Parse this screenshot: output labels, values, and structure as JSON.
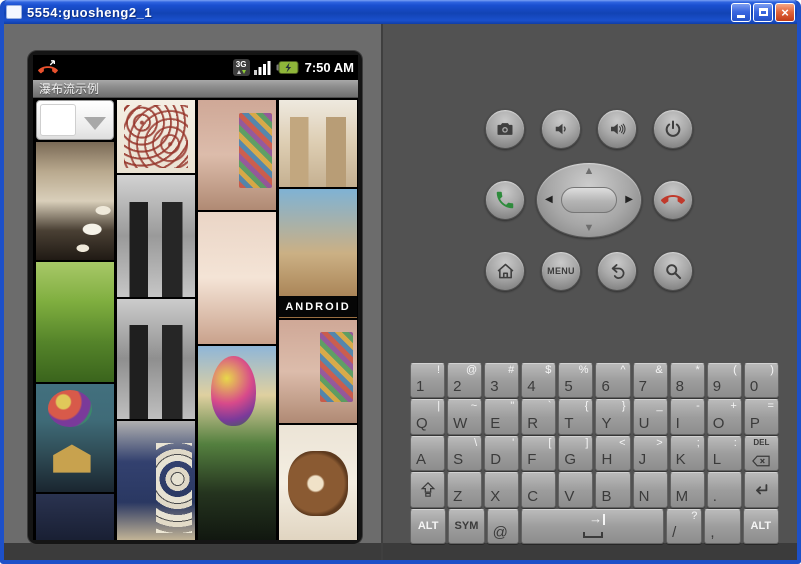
{
  "window": {
    "title": "5554:guosheng2_1",
    "controls": [
      {
        "name": "minimize",
        "icon": "underscore"
      },
      {
        "name": "maximize",
        "icon": "square"
      },
      {
        "name": "close",
        "icon": "x"
      }
    ]
  },
  "colors": {
    "titlebar_blue": "#1a4fd0",
    "panel_left": "#6c6c6c",
    "panel_right": "#525252",
    "call_green": "#2e8b3c",
    "hangup_red": "#c0392b",
    "battery_green": "#8fb63a",
    "missed_call_orange": "#e8512d",
    "key_main_text": "#3b3b3b",
    "key_alt_text": "#f5f5f5"
  },
  "device": {
    "status_bar": {
      "time": "7:50 AM",
      "network_label": "3G",
      "icons": [
        "missed-call",
        "3g-data",
        "signal-strength",
        "battery-charging"
      ]
    },
    "app_title": "瀑布流示例",
    "waterfall": {
      "columns": [
        [
          {
            "type": "spinner",
            "h": 40
          },
          {
            "label": "lily-portrait",
            "h": 118,
            "colors": [
              "#7a6a56",
              "#b9a98e",
              "#d9cfba",
              "#4a4034",
              "#201a14"
            ],
            "accent": "lily"
          },
          {
            "label": "meadow",
            "h": 120,
            "colors": [
              "#a8c868",
              "#7fae3f",
              "#55842a",
              "#3a641c"
            ]
          },
          {
            "label": "up-house-cake",
            "h": 108,
            "colors": [
              "#42707e",
              "#3f6b78",
              "#2e4a54",
              "#1a2630"
            ],
            "accent": "house"
          },
          {
            "label": "night-clouds",
            "h": 52,
            "colors": [
              "#2a3350",
              "#171d30"
            ]
          }
        ],
        [
          {
            "label": "caricatures",
            "h": 73,
            "colors": [
              "#f4efe4",
              "#eae1d2"
            ],
            "accent": "scribble"
          },
          {
            "label": "bw-models-1",
            "h": 122,
            "colors": [
              "#d2d2d2",
              "#9a9a9a",
              "#c6c6c6"
            ],
            "accent": "figures"
          },
          {
            "label": "bw-models-2",
            "h": 120,
            "colors": [
              "#cccccc",
              "#8f8f8f",
              "#bfbfbf"
            ],
            "accent": "figures"
          },
          {
            "label": "new-year-cookies",
            "h": 122,
            "colors": [
              "#b0b0b0",
              "#33416f",
              "#2a3862",
              "#cdbd9a"
            ],
            "accent": "clocks"
          }
        ],
        [
          {
            "label": "craft-shelf",
            "h": 110,
            "colors": [
              "#cfa897",
              "#dcbcab",
              "#b08a74"
            ],
            "accent": "patch"
          },
          {
            "label": "hands",
            "h": 132,
            "colors": [
              "#ead5c6",
              "#f4e4d6",
              "#c9a28c"
            ]
          },
          {
            "label": "balloon-landscape",
            "h": 196,
            "colors": [
              "#8fb6d8",
              "#dfd0a0",
              "#54803f",
              "#25341f",
              "#10160f"
            ],
            "accent": "balloon"
          }
        ],
        [
          {
            "label": "fashion-models",
            "h": 87,
            "colors": [
              "#eee9df",
              "#ddcdb2",
              "#c5b091"
            ],
            "accent": "models"
          },
          {
            "label": "beach-android",
            "h": 129,
            "colors": [
              "#7fb2d4",
              "#cbb084",
              "#9a6f42"
            ],
            "text": "ANDROID"
          },
          {
            "label": "craft-shelf-2",
            "h": 103,
            "colors": [
              "#cfa897",
              "#dcbcab",
              "#b08a74"
            ],
            "accent": "patch"
          },
          {
            "label": "swiss-roll",
            "h": 117,
            "colors": [
              "#ece4d6",
              "#f4eee2",
              "#e0d4c0"
            ],
            "accent": "roll"
          }
        ]
      ]
    }
  },
  "controls": {
    "row1": [
      "camera",
      "volume-down",
      "volume-up",
      "power"
    ],
    "row2": [
      "call",
      "dpad",
      "hang-up"
    ],
    "row3": [
      "home",
      "menu",
      "back",
      "search"
    ],
    "dpad": [
      "up",
      "down",
      "left",
      "right",
      "center"
    ],
    "menu_label": "MENU"
  },
  "keyboard": {
    "rows": [
      [
        {
          "m": "1",
          "a": "!"
        },
        {
          "m": "2",
          "a": "@"
        },
        {
          "m": "3",
          "a": "#"
        },
        {
          "m": "4",
          "a": "$"
        },
        {
          "m": "5",
          "a": "%"
        },
        {
          "m": "6",
          "a": "^"
        },
        {
          "m": "7",
          "a": "&"
        },
        {
          "m": "8",
          "a": "*"
        },
        {
          "m": "9",
          "a": "("
        },
        {
          "m": "0",
          "a": ")"
        }
      ],
      [
        {
          "m": "Q",
          "a": "|"
        },
        {
          "m": "W",
          "a": "~"
        },
        {
          "m": "E",
          "a": "\""
        },
        {
          "m": "R",
          "a": "`"
        },
        {
          "m": "T",
          "a": "{"
        },
        {
          "m": "Y",
          "a": "}"
        },
        {
          "m": "U",
          "a": "_"
        },
        {
          "m": "I",
          "a": "-"
        },
        {
          "m": "O",
          "a": "+"
        },
        {
          "m": "P",
          "a": "="
        }
      ],
      [
        {
          "m": "A"
        },
        {
          "m": "S",
          "a": "\\"
        },
        {
          "m": "D",
          "a": "'"
        },
        {
          "m": "F",
          "a": "["
        },
        {
          "m": "G",
          "a": "]"
        },
        {
          "m": "H",
          "a": "<"
        },
        {
          "m": "J",
          "a": ">"
        },
        {
          "m": "K",
          "a": ";"
        },
        {
          "m": "L",
          "a": ":"
        },
        {
          "type": "del",
          "label": "DEL"
        }
      ],
      [
        {
          "type": "shift"
        },
        {
          "m": "Z"
        },
        {
          "m": "X"
        },
        {
          "m": "C"
        },
        {
          "m": "V"
        },
        {
          "m": "B"
        },
        {
          "m": "N"
        },
        {
          "m": "M"
        },
        {
          "m": "."
        },
        {
          "type": "enter"
        }
      ],
      [
        {
          "type": "alt",
          "label": "ALT"
        },
        {
          "type": "sym",
          "label": "SYM"
        },
        {
          "m": "@",
          "flex": 0.9
        },
        {
          "type": "space",
          "flex": 4.1
        },
        {
          "m": "/",
          "a": "?"
        },
        {
          "m": ","
        },
        {
          "type": "alt",
          "label": "ALT"
        }
      ]
    ]
  }
}
